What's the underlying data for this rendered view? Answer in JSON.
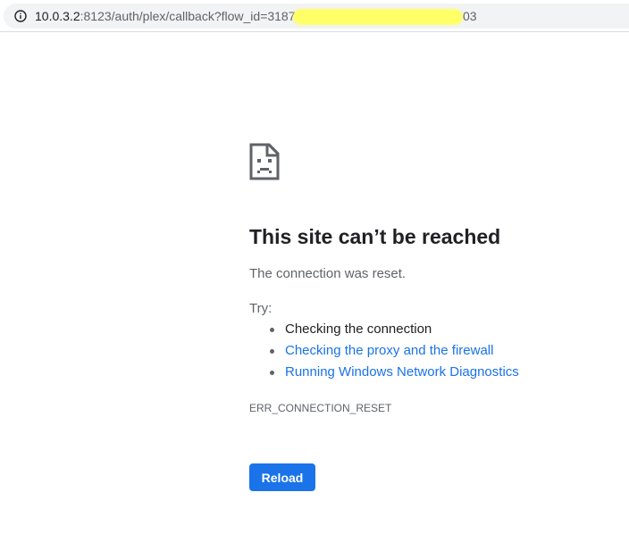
{
  "address_bar": {
    "url_host": "10.0.3.2",
    "url_path": ":8123/auth/plex/callback?flow_id=3187",
    "url_tail": "03",
    "info_icon": "info-circle-icon"
  },
  "error_page": {
    "icon": "sad-page-icon",
    "title": "This site can’t be reached",
    "description": "The connection was reset.",
    "try_label": "Try:",
    "suggestions": [
      {
        "text": "Checking the connection",
        "link": false
      },
      {
        "text": "Checking the proxy and the firewall",
        "link": true
      },
      {
        "text": "Running Windows Network Diagnostics",
        "link": true
      }
    ],
    "error_code": "ERR_CONNECTION_RESET",
    "reload_label": "Reload"
  },
  "colors": {
    "accent": "#1a73e8",
    "text_primary": "#202124",
    "text_secondary": "#5f6368",
    "redaction": "#ffff66"
  }
}
